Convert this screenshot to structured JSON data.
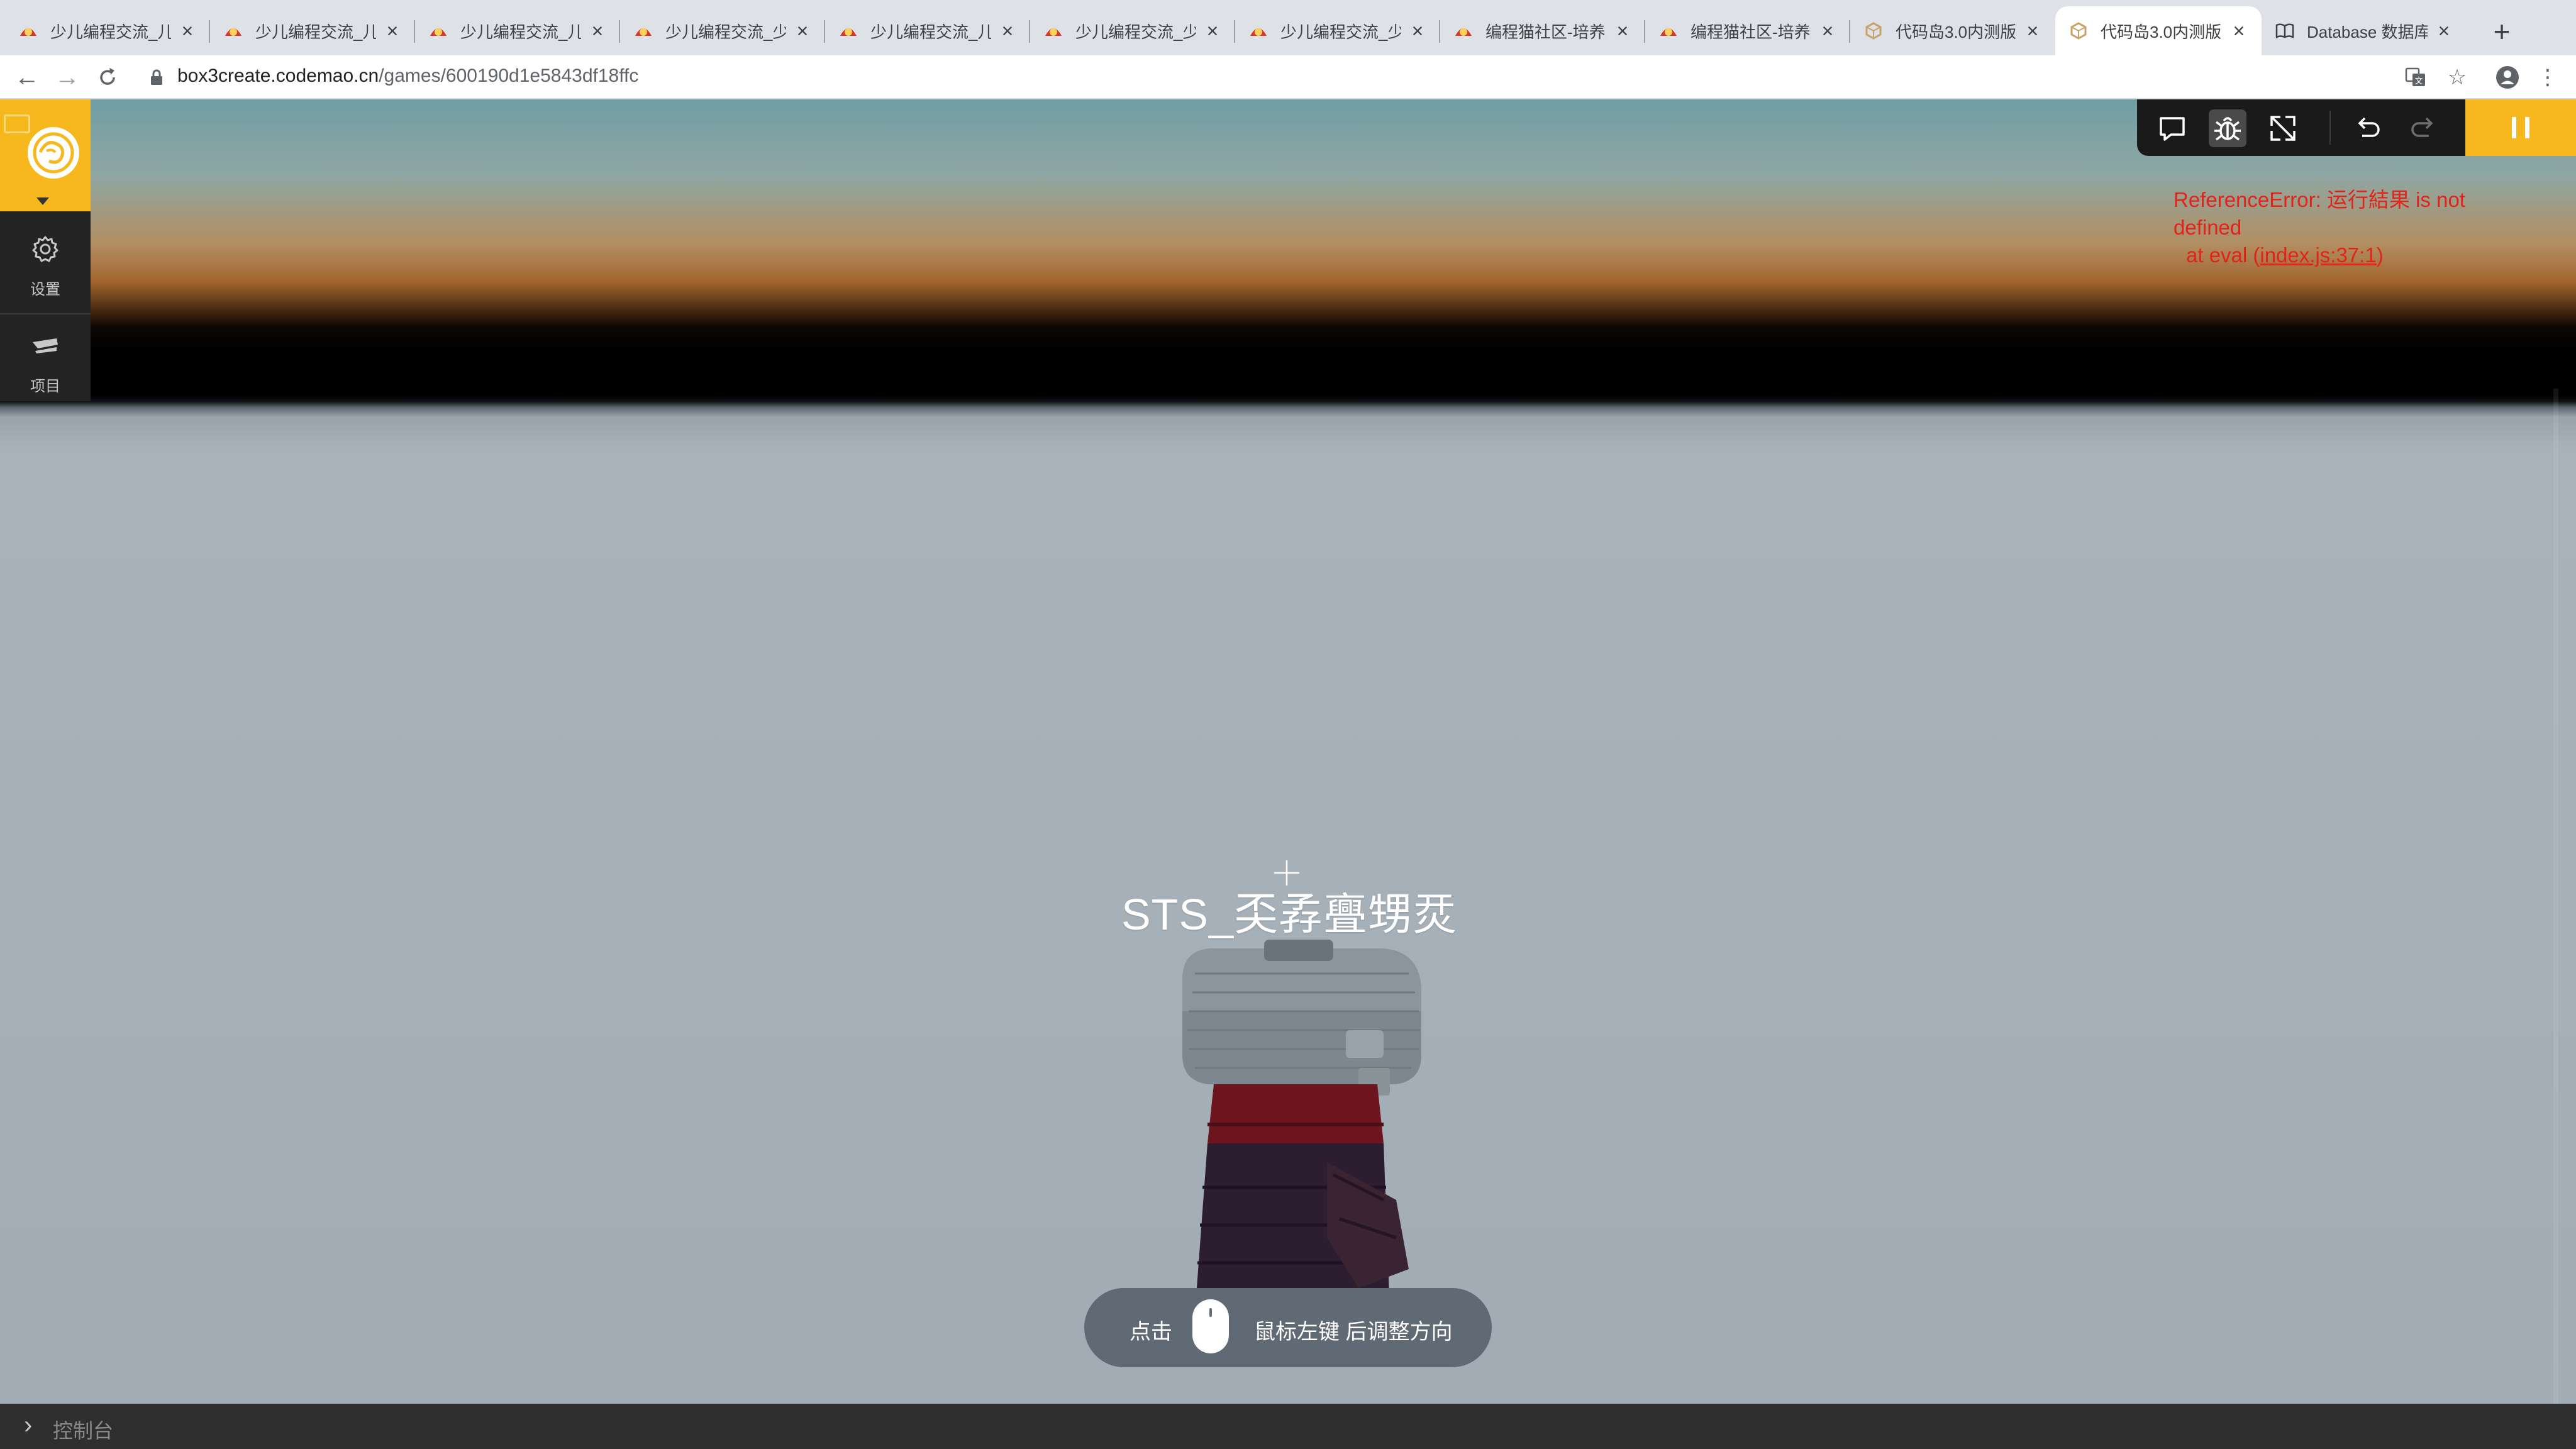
{
  "browser": {
    "tabs": [
      {
        "title": "少儿编程交流_儿童",
        "favicon": "codemao-icon",
        "active": false
      },
      {
        "title": "少儿编程交流_儿童",
        "favicon": "codemao-icon",
        "active": false
      },
      {
        "title": "少儿编程交流_儿童",
        "favicon": "codemao-icon",
        "active": false
      },
      {
        "title": "少儿编程交流_少儿",
        "favicon": "codemao-icon",
        "active": false
      },
      {
        "title": "少儿编程交流_儿童",
        "favicon": "codemao-icon",
        "active": false
      },
      {
        "title": "少儿编程交流_少儿",
        "favicon": "codemao-icon",
        "active": false
      },
      {
        "title": "少儿编程交流_少儿",
        "favicon": "codemao-icon",
        "active": false
      },
      {
        "title": "编程猫社区-培养未",
        "favicon": "codemao-icon",
        "active": false
      },
      {
        "title": "编程猫社区-培养未",
        "favicon": "codemao-icon",
        "active": false
      },
      {
        "title": "代码岛3.0内测版",
        "favicon": "box3-icon",
        "active": false
      },
      {
        "title": "代码岛3.0内测版",
        "favicon": "box3-icon",
        "active": true
      },
      {
        "title": "Database 数据库",
        "favicon": "book-icon",
        "active": false
      }
    ],
    "new_tab": "+",
    "url_host": "box3create.codemao.cn",
    "url_path": "/games/600190d1e5843df18ffc"
  },
  "sidebar": {
    "items": [
      {
        "label": "设置",
        "icon": "gear-icon"
      },
      {
        "label": "项目",
        "icon": "project-icon"
      }
    ]
  },
  "controls": {
    "buttons": [
      "chat-icon",
      "bug-icon",
      "fullscreen-icon",
      "undo-icon",
      "redo-icon"
    ],
    "active": "bug-icon",
    "pause": "pause-icon"
  },
  "error": {
    "line1": "ReferenceError: 运行結果 is not defined",
    "line2_prefix": "at eval (",
    "line2_link": "index.js:37:1",
    "line2_suffix": ")"
  },
  "game": {
    "player_name": "STS_奀孨亹甥烎",
    "hint_prefix": "点击",
    "hint_suffix": "鼠标左键  后调整方向"
  },
  "console": {
    "label": "控制台"
  },
  "colors": {
    "accent": "#f6b81c",
    "error": "#e2231a",
    "sidebar": "#242424"
  }
}
